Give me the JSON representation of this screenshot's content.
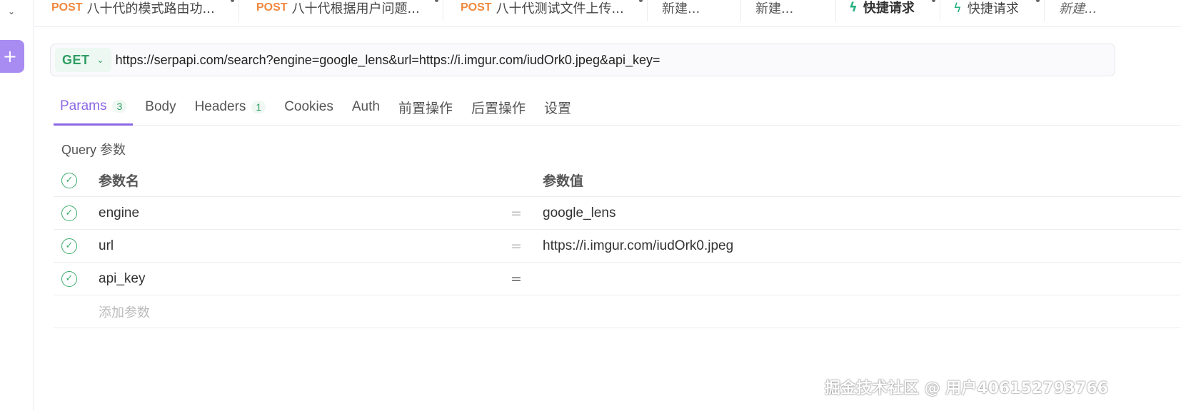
{
  "rail": {
    "chevron": "⌄",
    "add": "+"
  },
  "tabs": [
    {
      "method": "POST",
      "label": "八十代的模式路由功..."
    },
    {
      "method": "POST",
      "label": "八十代根据用户问题..."
    },
    {
      "method": "POST",
      "label": "八十代测试文件上传..."
    },
    {
      "label": "新建..."
    },
    {
      "label": "新建..."
    },
    {
      "label": "快捷请求",
      "bolt": "ϟ"
    },
    {
      "label": "快捷请求",
      "bolt": "ϟ"
    },
    {
      "label": "新建..."
    }
  ],
  "request": {
    "method": "GET",
    "url": "https://serpapi.com/search?engine=google_lens&url=https://i.imgur.com/iudOrk0.jpeg&api_key="
  },
  "subtabs": [
    {
      "label": "Params",
      "count": "3"
    },
    {
      "label": "Body"
    },
    {
      "label": "Headers",
      "count": "1"
    },
    {
      "label": "Cookies"
    },
    {
      "label": "Auth"
    },
    {
      "label": "前置操作"
    },
    {
      "label": "后置操作"
    },
    {
      "label": "设置"
    }
  ],
  "query": {
    "title": "Query 参数",
    "header": {
      "name": "参数名",
      "value": "参数值"
    },
    "rows": [
      {
        "name": "engine",
        "eq": "=",
        "value": "google_lens"
      },
      {
        "name": "url",
        "eq": "=",
        "value": "https://i.imgur.com/iudOrk0.jpeg"
      },
      {
        "name": "api_key",
        "eq": "=",
        "value": ""
      }
    ],
    "add_placeholder": "添加参数"
  },
  "watermark": "掘金技术社区 @ 用户406152793766",
  "colors": {
    "accent": "#8b67e6",
    "get": "#2f9e63",
    "post": "#f0883e",
    "check": "#3bab6b"
  }
}
